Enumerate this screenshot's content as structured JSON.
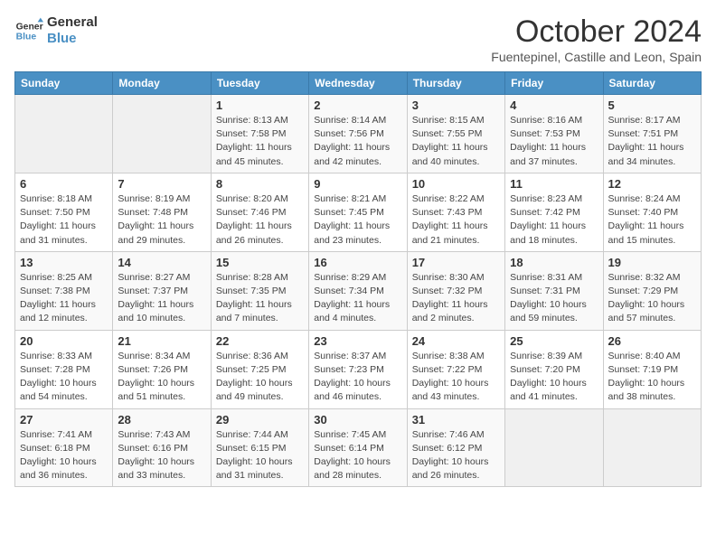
{
  "header": {
    "logo_line1": "General",
    "logo_line2": "Blue",
    "month": "October 2024",
    "location": "Fuentepinel, Castille and Leon, Spain"
  },
  "days_of_week": [
    "Sunday",
    "Monday",
    "Tuesday",
    "Wednesday",
    "Thursday",
    "Friday",
    "Saturday"
  ],
  "weeks": [
    [
      {
        "day": "",
        "detail": ""
      },
      {
        "day": "",
        "detail": ""
      },
      {
        "day": "1",
        "detail": "Sunrise: 8:13 AM\nSunset: 7:58 PM\nDaylight: 11 hours and 45 minutes."
      },
      {
        "day": "2",
        "detail": "Sunrise: 8:14 AM\nSunset: 7:56 PM\nDaylight: 11 hours and 42 minutes."
      },
      {
        "day": "3",
        "detail": "Sunrise: 8:15 AM\nSunset: 7:55 PM\nDaylight: 11 hours and 40 minutes."
      },
      {
        "day": "4",
        "detail": "Sunrise: 8:16 AM\nSunset: 7:53 PM\nDaylight: 11 hours and 37 minutes."
      },
      {
        "day": "5",
        "detail": "Sunrise: 8:17 AM\nSunset: 7:51 PM\nDaylight: 11 hours and 34 minutes."
      }
    ],
    [
      {
        "day": "6",
        "detail": "Sunrise: 8:18 AM\nSunset: 7:50 PM\nDaylight: 11 hours and 31 minutes."
      },
      {
        "day": "7",
        "detail": "Sunrise: 8:19 AM\nSunset: 7:48 PM\nDaylight: 11 hours and 29 minutes."
      },
      {
        "day": "8",
        "detail": "Sunrise: 8:20 AM\nSunset: 7:46 PM\nDaylight: 11 hours and 26 minutes."
      },
      {
        "day": "9",
        "detail": "Sunrise: 8:21 AM\nSunset: 7:45 PM\nDaylight: 11 hours and 23 minutes."
      },
      {
        "day": "10",
        "detail": "Sunrise: 8:22 AM\nSunset: 7:43 PM\nDaylight: 11 hours and 21 minutes."
      },
      {
        "day": "11",
        "detail": "Sunrise: 8:23 AM\nSunset: 7:42 PM\nDaylight: 11 hours and 18 minutes."
      },
      {
        "day": "12",
        "detail": "Sunrise: 8:24 AM\nSunset: 7:40 PM\nDaylight: 11 hours and 15 minutes."
      }
    ],
    [
      {
        "day": "13",
        "detail": "Sunrise: 8:25 AM\nSunset: 7:38 PM\nDaylight: 11 hours and 12 minutes."
      },
      {
        "day": "14",
        "detail": "Sunrise: 8:27 AM\nSunset: 7:37 PM\nDaylight: 11 hours and 10 minutes."
      },
      {
        "day": "15",
        "detail": "Sunrise: 8:28 AM\nSunset: 7:35 PM\nDaylight: 11 hours and 7 minutes."
      },
      {
        "day": "16",
        "detail": "Sunrise: 8:29 AM\nSunset: 7:34 PM\nDaylight: 11 hours and 4 minutes."
      },
      {
        "day": "17",
        "detail": "Sunrise: 8:30 AM\nSunset: 7:32 PM\nDaylight: 11 hours and 2 minutes."
      },
      {
        "day": "18",
        "detail": "Sunrise: 8:31 AM\nSunset: 7:31 PM\nDaylight: 10 hours and 59 minutes."
      },
      {
        "day": "19",
        "detail": "Sunrise: 8:32 AM\nSunset: 7:29 PM\nDaylight: 10 hours and 57 minutes."
      }
    ],
    [
      {
        "day": "20",
        "detail": "Sunrise: 8:33 AM\nSunset: 7:28 PM\nDaylight: 10 hours and 54 minutes."
      },
      {
        "day": "21",
        "detail": "Sunrise: 8:34 AM\nSunset: 7:26 PM\nDaylight: 10 hours and 51 minutes."
      },
      {
        "day": "22",
        "detail": "Sunrise: 8:36 AM\nSunset: 7:25 PM\nDaylight: 10 hours and 49 minutes."
      },
      {
        "day": "23",
        "detail": "Sunrise: 8:37 AM\nSunset: 7:23 PM\nDaylight: 10 hours and 46 minutes."
      },
      {
        "day": "24",
        "detail": "Sunrise: 8:38 AM\nSunset: 7:22 PM\nDaylight: 10 hours and 43 minutes."
      },
      {
        "day": "25",
        "detail": "Sunrise: 8:39 AM\nSunset: 7:20 PM\nDaylight: 10 hours and 41 minutes."
      },
      {
        "day": "26",
        "detail": "Sunrise: 8:40 AM\nSunset: 7:19 PM\nDaylight: 10 hours and 38 minutes."
      }
    ],
    [
      {
        "day": "27",
        "detail": "Sunrise: 7:41 AM\nSunset: 6:18 PM\nDaylight: 10 hours and 36 minutes."
      },
      {
        "day": "28",
        "detail": "Sunrise: 7:43 AM\nSunset: 6:16 PM\nDaylight: 10 hours and 33 minutes."
      },
      {
        "day": "29",
        "detail": "Sunrise: 7:44 AM\nSunset: 6:15 PM\nDaylight: 10 hours and 31 minutes."
      },
      {
        "day": "30",
        "detail": "Sunrise: 7:45 AM\nSunset: 6:14 PM\nDaylight: 10 hours and 28 minutes."
      },
      {
        "day": "31",
        "detail": "Sunrise: 7:46 AM\nSunset: 6:12 PM\nDaylight: 10 hours and 26 minutes."
      },
      {
        "day": "",
        "detail": ""
      },
      {
        "day": "",
        "detail": ""
      }
    ]
  ]
}
